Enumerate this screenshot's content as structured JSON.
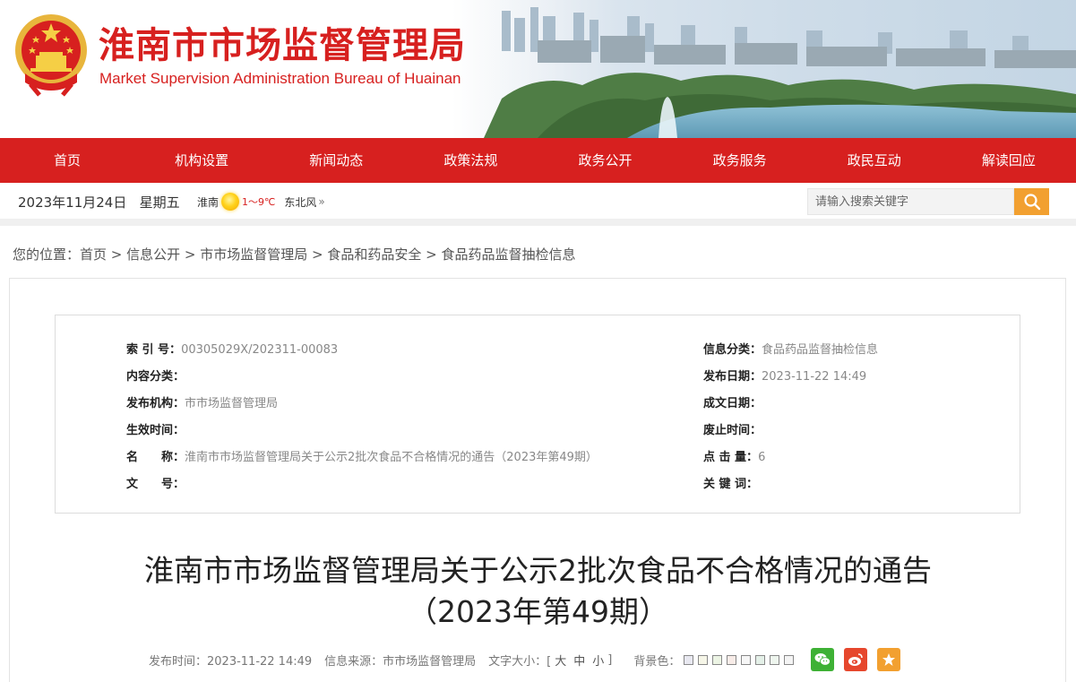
{
  "header": {
    "title": "淮南市市场监督管理局",
    "subtitle": "Market Supervision Administration Bureau of Huainan",
    "brand_color": "#d7201f"
  },
  "nav": {
    "items": [
      {
        "label": "首页"
      },
      {
        "label": "机构设置"
      },
      {
        "label": "新闻动态"
      },
      {
        "label": "政策法规"
      },
      {
        "label": "政务公开"
      },
      {
        "label": "政务服务"
      },
      {
        "label": "政民互动"
      },
      {
        "label": "解读回应"
      }
    ]
  },
  "infobar": {
    "date": "2023年11月24日",
    "weekday": "星期五",
    "city": "淮南",
    "weather_icon": "sun-icon",
    "temperature": "1～9℃",
    "wind": "东北风",
    "wind_arrow": "»"
  },
  "search": {
    "placeholder": "请输入搜索关键字",
    "button_color": "#f2a030"
  },
  "breadcrumb": {
    "prefix": "您的位置：",
    "items": [
      "首页",
      "信息公开",
      "市市场监督管理局",
      "食品和药品安全",
      "食品药品监督抽检信息"
    ],
    "separator": " > "
  },
  "meta": {
    "left": [
      {
        "label": "索 引 号：",
        "value": "00305029X/202311-00083"
      },
      {
        "label": "内容分类：",
        "value": ""
      },
      {
        "label": "发布机构：",
        "value": "市市场监督管理局"
      },
      {
        "label": "生效时间：",
        "value": ""
      },
      {
        "label": "名　　称：",
        "value": "淮南市市场监督管理局关于公示2批次食品不合格情况的通告（2023年第49期）"
      },
      {
        "label": "文　　号：",
        "value": ""
      }
    ],
    "right": [
      {
        "label": "信息分类：",
        "value": "食品药品监督抽检信息"
      },
      {
        "label": "发布日期：",
        "value": "2023-11-22 14:49"
      },
      {
        "label": "成文日期：",
        "value": ""
      },
      {
        "label": "废止时间：",
        "value": ""
      },
      {
        "label": "点 击 量：",
        "value": "6"
      },
      {
        "label": "关 键 词：",
        "value": ""
      }
    ]
  },
  "article": {
    "title_line1": "淮南市市场监督管理局关于公示2批次食品不合格情况的通告",
    "title_line2": "（2023年第49期）"
  },
  "pubinfo": {
    "publish_time": "发布时间：2023-11-22 14:49",
    "source": "信息来源：市市场监督管理局",
    "font_size_label": "文字大小：[",
    "font_sizes": [
      "大",
      "中",
      "小"
    ],
    "font_size_close": "]",
    "bg_label": "背景色：",
    "bg_colors": [
      "#e8e8f0",
      "#f6f6e8",
      "#ecf4e4",
      "#f8ece8",
      "#f6f6f6",
      "#e4f0e8",
      "#eef6ee",
      "#f4f4f4"
    ],
    "share_icons": [
      {
        "name": "wechat-icon",
        "color": "#3eb135"
      },
      {
        "name": "weibo-icon",
        "color": "#e6472d"
      },
      {
        "name": "favorite-star-icon",
        "color": "#f2a030"
      }
    ]
  }
}
